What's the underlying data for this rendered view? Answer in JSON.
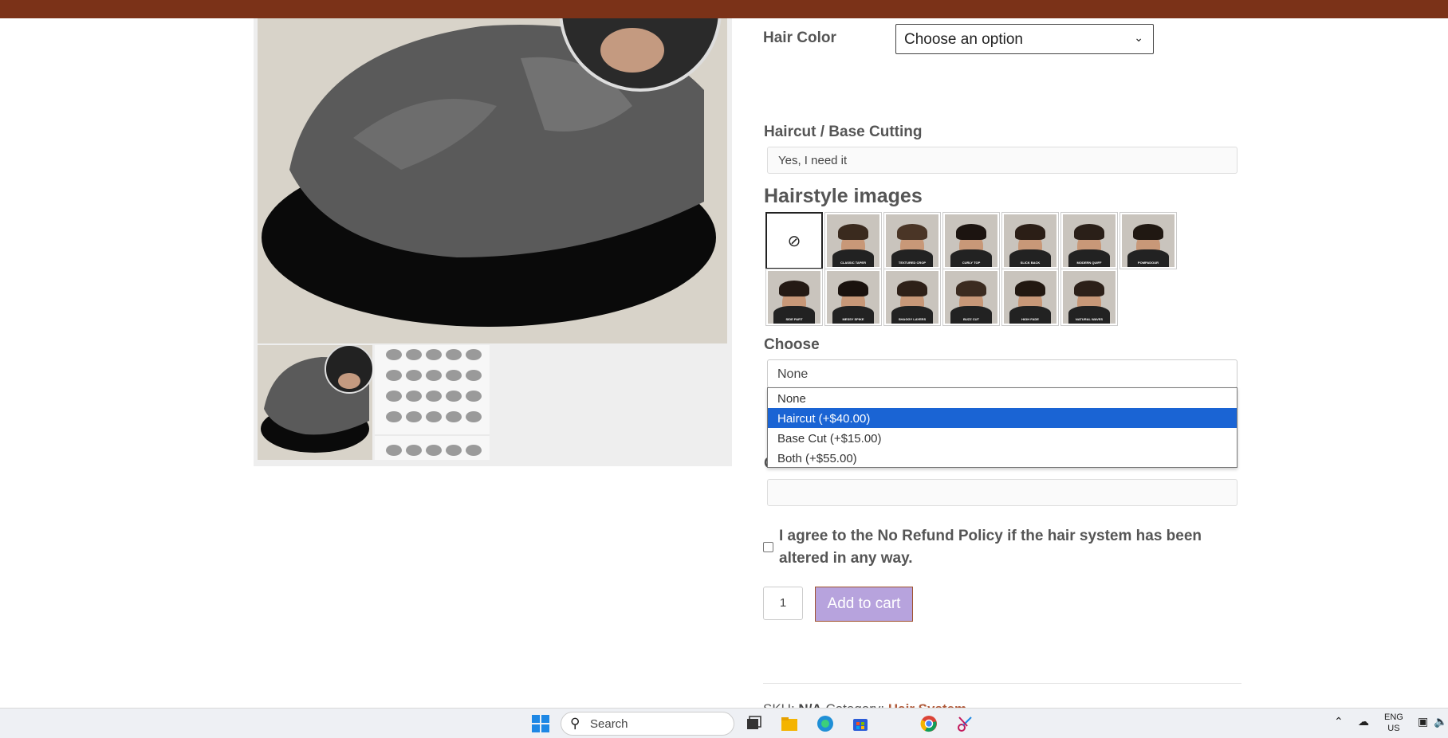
{
  "form": {
    "hair_color_label": "Hair Color",
    "hair_color_value": "Choose an option",
    "haircut_label": "Haircut / Base Cutting",
    "haircut_value": "Yes, I need it",
    "hairstyle_heading": "Hairstyle images",
    "hairstyles": [
      {
        "caption": "CLASSIC TAPER",
        "hair": "#3a2a1e"
      },
      {
        "caption": "TEXTURED CROP",
        "hair": "#4a3526"
      },
      {
        "caption": "CURLY TOP",
        "hair": "#1c1410"
      },
      {
        "caption": "SLICK BACK",
        "hair": "#2b1e16"
      },
      {
        "caption": "MODERN QUIFF",
        "hair": "#2a1f18"
      },
      {
        "caption": "POMPADOUR",
        "hair": "#201812"
      },
      {
        "caption": "SIDE PART",
        "hair": "#241a14"
      },
      {
        "caption": "MESSY SPIKE",
        "hair": "#1a120e"
      },
      {
        "caption": "SHAGGY LAYERS",
        "hair": "#2e2018"
      },
      {
        "caption": "BUZZ CUT",
        "hair": "#3b2b20"
      },
      {
        "caption": "HIGH FADE",
        "hair": "#221811"
      },
      {
        "caption": "NATURAL WAVES",
        "hair": "#2c2019"
      }
    ],
    "choose_label": "Choose",
    "choose_value": "None",
    "choose_options": [
      "None",
      "Haircut (+$40.00)",
      "Base Cut (+$15.00)",
      "Both (+$55.00)"
    ],
    "choose_selected_index": 1,
    "other_size_label": "Other Size",
    "agree_text": "I agree to the No Refund Policy if the hair system has been altered in any way.",
    "qty": "1",
    "add_to_cart": "Add to cart",
    "sku_label": "SKU:",
    "sku_value": "N/A",
    "category_label": "Category:",
    "category_value": "Hair System"
  },
  "taskbar": {
    "search_placeholder": "Search",
    "lang_top": "ENG",
    "lang_bottom": "US"
  },
  "colors": {
    "topbar": "#7b3218",
    "accent_selected": "#1a64d4",
    "cart_button": "#b7a3dd"
  }
}
